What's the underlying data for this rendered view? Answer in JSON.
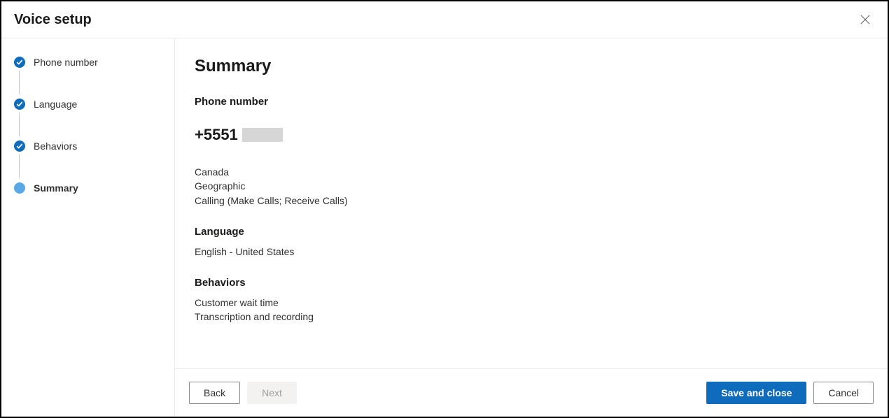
{
  "dialog": {
    "title": "Voice setup"
  },
  "stepper": {
    "steps": [
      {
        "label": "Phone number",
        "state": "completed"
      },
      {
        "label": "Language",
        "state": "completed"
      },
      {
        "label": "Behaviors",
        "state": "completed"
      },
      {
        "label": "Summary",
        "state": "active"
      }
    ]
  },
  "content": {
    "title": "Summary",
    "phone": {
      "label": "Phone number",
      "value": "+5551",
      "country": "Canada",
      "type": "Geographic",
      "capabilities": "Calling (Make Calls; Receive Calls)"
    },
    "language": {
      "label": "Language",
      "value": "English - United States"
    },
    "behaviors": {
      "label": "Behaviors",
      "items": [
        "Customer wait time",
        "Transcription and recording"
      ]
    }
  },
  "footer": {
    "back": "Back",
    "next": "Next",
    "save": "Save and close",
    "cancel": "Cancel"
  }
}
